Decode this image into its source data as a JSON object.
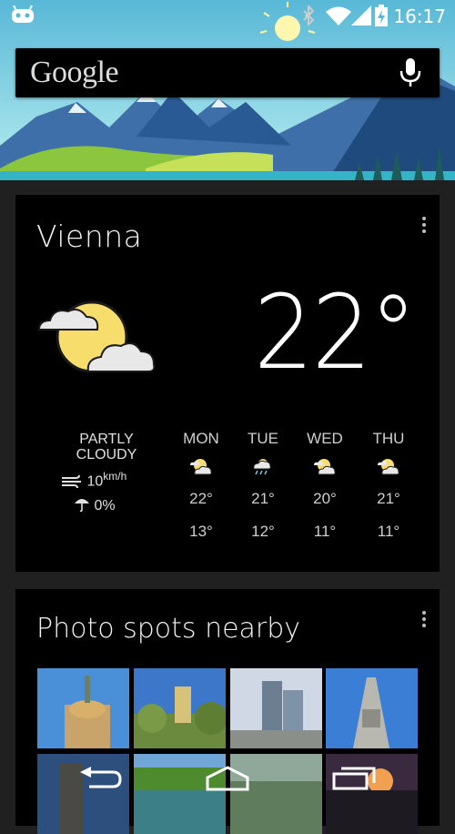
{
  "status_bar": {
    "time": "16:17",
    "icons": [
      "cyanogen-icon",
      "bluetooth-icon",
      "wifi-icon",
      "signal-icon",
      "battery-icon"
    ]
  },
  "search": {
    "logo": "Google",
    "mic_icon": "mic-icon"
  },
  "weather_card": {
    "city": "Vienna",
    "temperature": "22°",
    "condition_line1": "PARTLY",
    "condition_line2": "CLOUDY",
    "wind": "10",
    "wind_unit": "km/h",
    "rain": "0%",
    "forecast": [
      {
        "day": "MON",
        "high": "22°",
        "low": "13°",
        "icon": "partly-cloudy-icon"
      },
      {
        "day": "TUE",
        "high": "21°",
        "low": "12°",
        "icon": "cloud-rain-icon"
      },
      {
        "day": "WED",
        "high": "20°",
        "low": "11°",
        "icon": "partly-cloudy-icon"
      },
      {
        "day": "THU",
        "high": "21°",
        "low": "11°",
        "icon": "partly-cloudy-icon"
      }
    ]
  },
  "photos_card": {
    "title": "Photo spots nearby"
  },
  "colors": {
    "background": "#202020",
    "card": "#000000",
    "sun": "#f7de6c",
    "sky": "#7fd3e0"
  }
}
